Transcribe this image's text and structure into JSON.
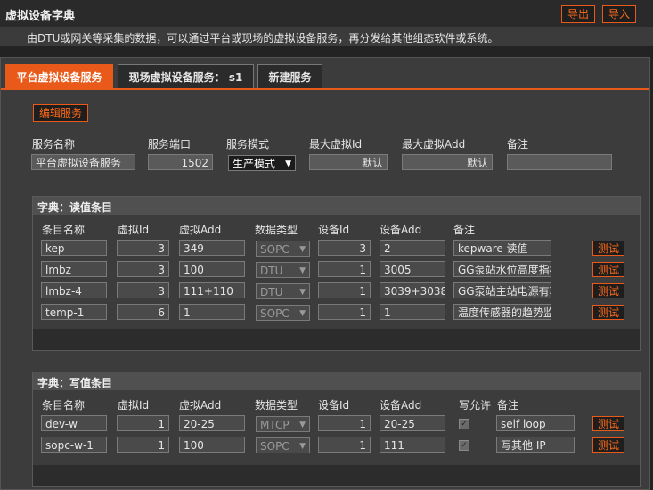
{
  "window": {
    "title": "虚拟设备字典",
    "export_label": "导出",
    "import_label": "导入"
  },
  "info": "由DTU或网关等采集的数据，可以通过平台或现场的虚拟设备服务，再分发给其他组态软件或系统。",
  "tabs": [
    {
      "label": "平台虚拟设备服务",
      "active": true
    },
    {
      "label": "现场虚拟设备服务： s1",
      "active": false
    },
    {
      "label": "新建服务",
      "active": false
    }
  ],
  "edit_service_label": "编辑服务",
  "service": {
    "headers": [
      "服务名称",
      "服务端口",
      "服务模式",
      "最大虚拟Id",
      "最大虚拟Add",
      "备注"
    ],
    "name": "平台虚拟设备服务",
    "port": "1502",
    "mode": "生产模式",
    "max_id": "默认",
    "max_add": "默认",
    "note": ""
  },
  "read_dict": {
    "title": "字典：读值条目",
    "headers": [
      "条目名称",
      "虚拟Id",
      "虚拟Add",
      "数据类型",
      "设备Id",
      "设备Add",
      "备注"
    ],
    "rows": [
      {
        "name": "kep",
        "vid": "3",
        "vadd": "349",
        "type": "SOPC",
        "did": "3",
        "dadd": "2",
        "note": "kepware 读值",
        "test": "测试"
      },
      {
        "name": "lmbz",
        "vid": "3",
        "vadd": "100",
        "type": "DTU",
        "did": "1",
        "dadd": "3005",
        "note": "GG泵站水位高度指标",
        "test": "测试"
      },
      {
        "name": "lmbz-4",
        "vid": "3",
        "vadd": "111+110",
        "type": "DTU",
        "did": "1",
        "dadd": "3039+3038",
        "note": "GG泵站主站电源有功电度",
        "test": "测试"
      },
      {
        "name": "temp-1",
        "vid": "6",
        "vadd": "1",
        "type": "SOPC",
        "did": "1",
        "dadd": "1",
        "note": "温度传感器的趋势监测值",
        "test": "测试"
      }
    ]
  },
  "write_dict": {
    "title": "字典：写值条目",
    "headers": [
      "条目名称",
      "虚拟Id",
      "虚拟Add",
      "数据类型",
      "设备Id",
      "设备Add",
      "写允许",
      "备注"
    ],
    "rows": [
      {
        "name": "dev-w",
        "vid": "1",
        "vadd": "20-25",
        "type": "MTCP",
        "did": "1",
        "dadd": "20-25",
        "write": true,
        "note": "self loop",
        "test": "测试"
      },
      {
        "name": "sopc-w-1",
        "vid": "1",
        "vadd": "100",
        "type": "SOPC",
        "did": "1",
        "dadd": "111",
        "write": true,
        "note": "写其他 IP",
        "test": "测试"
      }
    ]
  },
  "colors": {
    "accent": "#e8591a",
    "background": "#232323",
    "panel": "#3c3c3c"
  },
  "icons": {
    "select_arrow": "chevron-down-icon",
    "checkbox": "check-icon"
  }
}
